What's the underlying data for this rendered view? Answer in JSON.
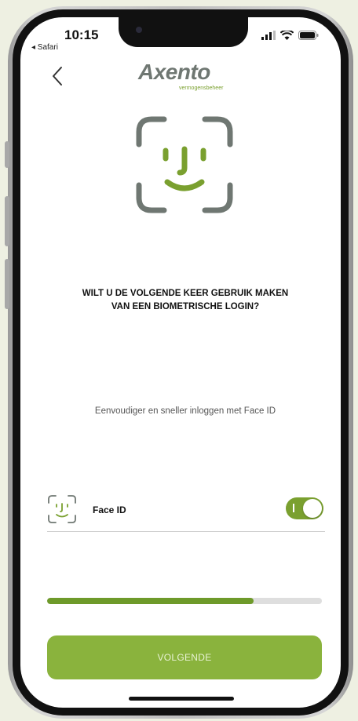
{
  "status_bar": {
    "time": "10:15",
    "back_app": "◂ Safari"
  },
  "header": {
    "back_icon": "chevron-left-icon",
    "logo_text": "Axento",
    "logo_subtext": "vermogensbeheer"
  },
  "colors": {
    "accent": "#7aa02f",
    "button": "#8ab33d",
    "icon_gray": "#6f7772"
  },
  "main": {
    "hero_icon": "face-id-icon",
    "heading": "WILT U DE VOLGENDE KEER GEBRUIK MAKEN\nVAN EEN BIOMETRISCHE LOGIN?",
    "subtext": "Eenvoudiger en sneller inloggen met Face ID"
  },
  "faceid_option": {
    "icon": "face-id-icon",
    "label": "Face ID",
    "enabled": true
  },
  "progress": {
    "fraction": 0.75
  },
  "footer": {
    "next_button": "VOLGENDE"
  }
}
